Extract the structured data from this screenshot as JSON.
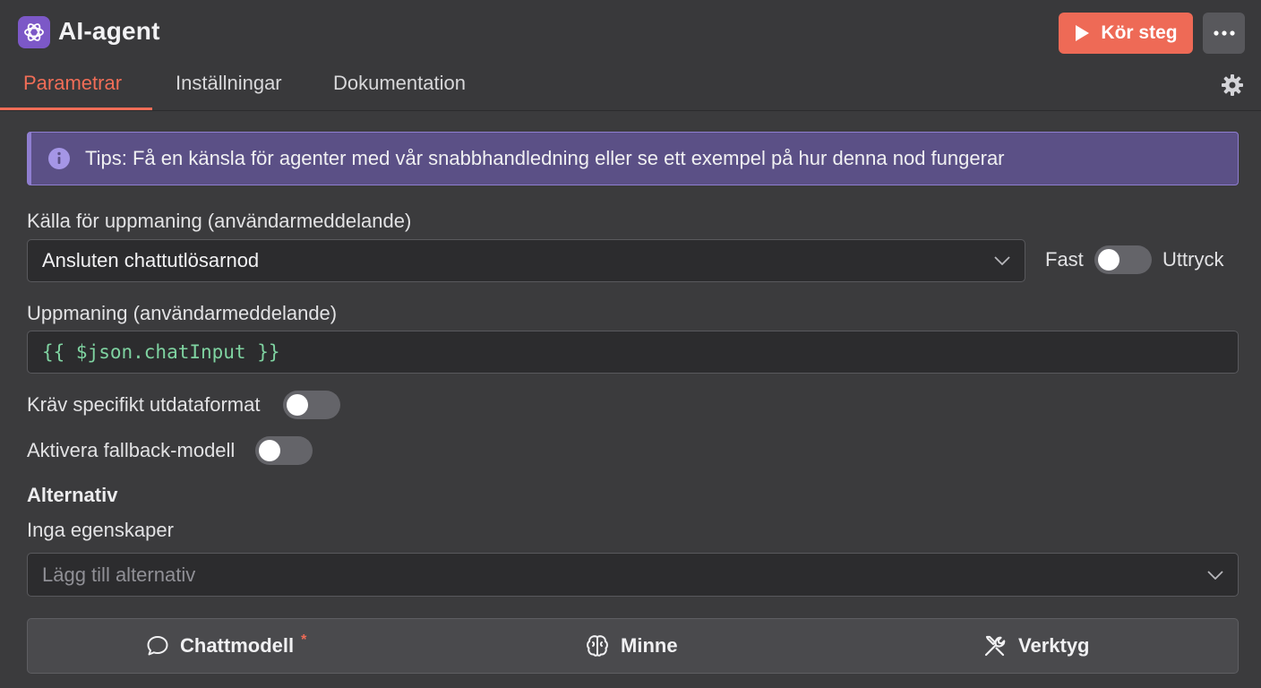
{
  "header": {
    "title": "AI-agent",
    "run_label": "Kör steg",
    "accent": "#ee6a56",
    "app_icon": "ai-model-icon"
  },
  "tabs": [
    {
      "label": "Parametrar",
      "active": true
    },
    {
      "label": "Inställningar",
      "active": false
    },
    {
      "label": "Dokumentation",
      "active": false
    }
  ],
  "notice": {
    "text": "Tips: Få en känsla för agenter med vår snabbhandledning eller se ett exempel på hur denna nod fungerar",
    "icon": "info-icon"
  },
  "prompt_source": {
    "label": "Källa för uppmaning (användarmeddelande)",
    "value": "Ansluten chattutlösarnod",
    "toggle_left": "Fast",
    "toggle_right": "Uttryck",
    "toggle_on": false
  },
  "prompt": {
    "label": "Uppmaning (användarmeddelande)",
    "value": "{{ $json.chatInput }}"
  },
  "require_format": {
    "label": "Kräv specifikt utdataformat",
    "on": false
  },
  "fallback": {
    "label": "Aktivera fallback-modell",
    "on": false
  },
  "options": {
    "title": "Alternativ",
    "empty_text": "Inga egenskaper",
    "add_placeholder": "Lägg till alternativ"
  },
  "connections": [
    {
      "label": "Chattmodell",
      "icon": "chat-bubble-icon",
      "required": "*"
    },
    {
      "label": "Minne",
      "icon": "brain-icon"
    },
    {
      "label": "Verktyg",
      "icon": "tools-icon"
    }
  ]
}
